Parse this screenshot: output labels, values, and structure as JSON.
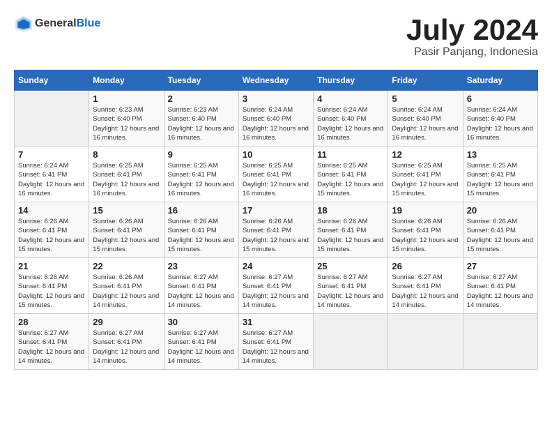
{
  "header": {
    "logo": {
      "general": "General",
      "blue": "Blue"
    },
    "month": "July 2024",
    "location": "Pasir Panjang, Indonesia"
  },
  "days_of_week": [
    "Sunday",
    "Monday",
    "Tuesday",
    "Wednesday",
    "Thursday",
    "Friday",
    "Saturday"
  ],
  "weeks": [
    [
      {
        "day": "",
        "info": ""
      },
      {
        "day": "1",
        "sunrise": "Sunrise: 6:23 AM",
        "sunset": "Sunset: 6:40 PM",
        "daylight": "Daylight: 12 hours and 16 minutes."
      },
      {
        "day": "2",
        "sunrise": "Sunrise: 6:23 AM",
        "sunset": "Sunset: 6:40 PM",
        "daylight": "Daylight: 12 hours and 16 minutes."
      },
      {
        "day": "3",
        "sunrise": "Sunrise: 6:24 AM",
        "sunset": "Sunset: 6:40 PM",
        "daylight": "Daylight: 12 hours and 16 minutes."
      },
      {
        "day": "4",
        "sunrise": "Sunrise: 6:24 AM",
        "sunset": "Sunset: 6:40 PM",
        "daylight": "Daylight: 12 hours and 16 minutes."
      },
      {
        "day": "5",
        "sunrise": "Sunrise: 6:24 AM",
        "sunset": "Sunset: 6:40 PM",
        "daylight": "Daylight: 12 hours and 16 minutes."
      },
      {
        "day": "6",
        "sunrise": "Sunrise: 6:24 AM",
        "sunset": "Sunset: 6:40 PM",
        "daylight": "Daylight: 12 hours and 16 minutes."
      }
    ],
    [
      {
        "day": "7",
        "sunrise": "Sunrise: 6:24 AM",
        "sunset": "Sunset: 6:41 PM",
        "daylight": "Daylight: 12 hours and 16 minutes."
      },
      {
        "day": "8",
        "sunrise": "Sunrise: 6:25 AM",
        "sunset": "Sunset: 6:41 PM",
        "daylight": "Daylight: 12 hours and 16 minutes."
      },
      {
        "day": "9",
        "sunrise": "Sunrise: 6:25 AM",
        "sunset": "Sunset: 6:41 PM",
        "daylight": "Daylight: 12 hours and 16 minutes."
      },
      {
        "day": "10",
        "sunrise": "Sunrise: 6:25 AM",
        "sunset": "Sunset: 6:41 PM",
        "daylight": "Daylight: 12 hours and 16 minutes."
      },
      {
        "day": "11",
        "sunrise": "Sunrise: 6:25 AM",
        "sunset": "Sunset: 6:41 PM",
        "daylight": "Daylight: 12 hours and 15 minutes."
      },
      {
        "day": "12",
        "sunrise": "Sunrise: 6:25 AM",
        "sunset": "Sunset: 6:41 PM",
        "daylight": "Daylight: 12 hours and 15 minutes."
      },
      {
        "day": "13",
        "sunrise": "Sunrise: 6:25 AM",
        "sunset": "Sunset: 6:41 PM",
        "daylight": "Daylight: 12 hours and 15 minutes."
      }
    ],
    [
      {
        "day": "14",
        "sunrise": "Sunrise: 6:26 AM",
        "sunset": "Sunset: 6:41 PM",
        "daylight": "Daylight: 12 hours and 15 minutes."
      },
      {
        "day": "15",
        "sunrise": "Sunrise: 6:26 AM",
        "sunset": "Sunset: 6:41 PM",
        "daylight": "Daylight: 12 hours and 15 minutes."
      },
      {
        "day": "16",
        "sunrise": "Sunrise: 6:26 AM",
        "sunset": "Sunset: 6:41 PM",
        "daylight": "Daylight: 12 hours and 15 minutes."
      },
      {
        "day": "17",
        "sunrise": "Sunrise: 6:26 AM",
        "sunset": "Sunset: 6:41 PM",
        "daylight": "Daylight: 12 hours and 15 minutes."
      },
      {
        "day": "18",
        "sunrise": "Sunrise: 6:26 AM",
        "sunset": "Sunset: 6:41 PM",
        "daylight": "Daylight: 12 hours and 15 minutes."
      },
      {
        "day": "19",
        "sunrise": "Sunrise: 6:26 AM",
        "sunset": "Sunset: 6:41 PM",
        "daylight": "Daylight: 12 hours and 15 minutes."
      },
      {
        "day": "20",
        "sunrise": "Sunrise: 6:26 AM",
        "sunset": "Sunset: 6:41 PM",
        "daylight": "Daylight: 12 hours and 15 minutes."
      }
    ],
    [
      {
        "day": "21",
        "sunrise": "Sunrise: 6:26 AM",
        "sunset": "Sunset: 6:41 PM",
        "daylight": "Daylight: 12 hours and 15 minutes."
      },
      {
        "day": "22",
        "sunrise": "Sunrise: 6:26 AM",
        "sunset": "Sunset: 6:41 PM",
        "daylight": "Daylight: 12 hours and 14 minutes."
      },
      {
        "day": "23",
        "sunrise": "Sunrise: 6:27 AM",
        "sunset": "Sunset: 6:41 PM",
        "daylight": "Daylight: 12 hours and 14 minutes."
      },
      {
        "day": "24",
        "sunrise": "Sunrise: 6:27 AM",
        "sunset": "Sunset: 6:41 PM",
        "daylight": "Daylight: 12 hours and 14 minutes."
      },
      {
        "day": "25",
        "sunrise": "Sunrise: 6:27 AM",
        "sunset": "Sunset: 6:41 PM",
        "daylight": "Daylight: 12 hours and 14 minutes."
      },
      {
        "day": "26",
        "sunrise": "Sunrise: 6:27 AM",
        "sunset": "Sunset: 6:41 PM",
        "daylight": "Daylight: 12 hours and 14 minutes."
      },
      {
        "day": "27",
        "sunrise": "Sunrise: 6:27 AM",
        "sunset": "Sunset: 6:41 PM",
        "daylight": "Daylight: 12 hours and 14 minutes."
      }
    ],
    [
      {
        "day": "28",
        "sunrise": "Sunrise: 6:27 AM",
        "sunset": "Sunset: 6:41 PM",
        "daylight": "Daylight: 12 hours and 14 minutes."
      },
      {
        "day": "29",
        "sunrise": "Sunrise: 6:27 AM",
        "sunset": "Sunset: 6:41 PM",
        "daylight": "Daylight: 12 hours and 14 minutes."
      },
      {
        "day": "30",
        "sunrise": "Sunrise: 6:27 AM",
        "sunset": "Sunset: 6:41 PM",
        "daylight": "Daylight: 12 hours and 14 minutes."
      },
      {
        "day": "31",
        "sunrise": "Sunrise: 6:27 AM",
        "sunset": "Sunset: 6:41 PM",
        "daylight": "Daylight: 12 hours and 14 minutes."
      },
      {
        "day": "",
        "info": ""
      },
      {
        "day": "",
        "info": ""
      },
      {
        "day": "",
        "info": ""
      }
    ]
  ]
}
